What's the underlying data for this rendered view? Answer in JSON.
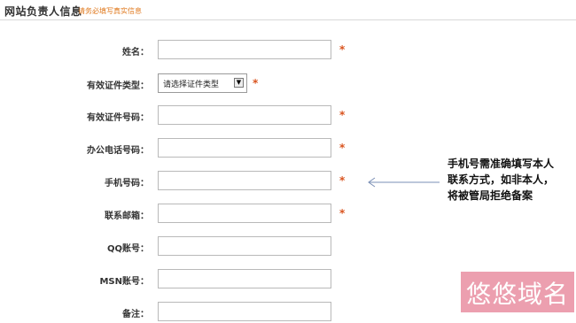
{
  "header": {
    "title": "网站负责人信息",
    "subtitle": "请务必填写真实信息"
  },
  "form": {
    "required_mark": "*",
    "fields": [
      {
        "label": "姓名：",
        "type": "text",
        "value": "",
        "required": true
      },
      {
        "label": "有效证件类型：",
        "type": "select",
        "selected": "请选择证件类型",
        "required": true
      },
      {
        "label": "有效证件号码：",
        "type": "text",
        "value": "",
        "required": true
      },
      {
        "label": "办公电话号码：",
        "type": "text",
        "value": "",
        "required": true
      },
      {
        "label": "手机号码：",
        "type": "text",
        "value": "",
        "required": true
      },
      {
        "label": "联系邮箱：",
        "type": "text",
        "value": "",
        "required": true
      },
      {
        "label": "QQ账号：",
        "type": "text",
        "value": "",
        "required": false
      },
      {
        "label": "MSN账号：",
        "type": "text",
        "value": "",
        "required": false
      },
      {
        "label": "备注：",
        "type": "text",
        "value": "",
        "required": false
      }
    ]
  },
  "note": {
    "lines": [
      "手机号需准确填写本人",
      "联系方式，如非本人，",
      "将被管局拒绝备案"
    ]
  },
  "watermark": {
    "text": "悠悠域名"
  },
  "icons": {
    "arrow": "left-arrow-icon",
    "dropdown": "chevron-down-icon"
  },
  "colors": {
    "subtitle": "#e07a1f",
    "required": "#d9531e",
    "watermark_bg": "#dc506e"
  }
}
